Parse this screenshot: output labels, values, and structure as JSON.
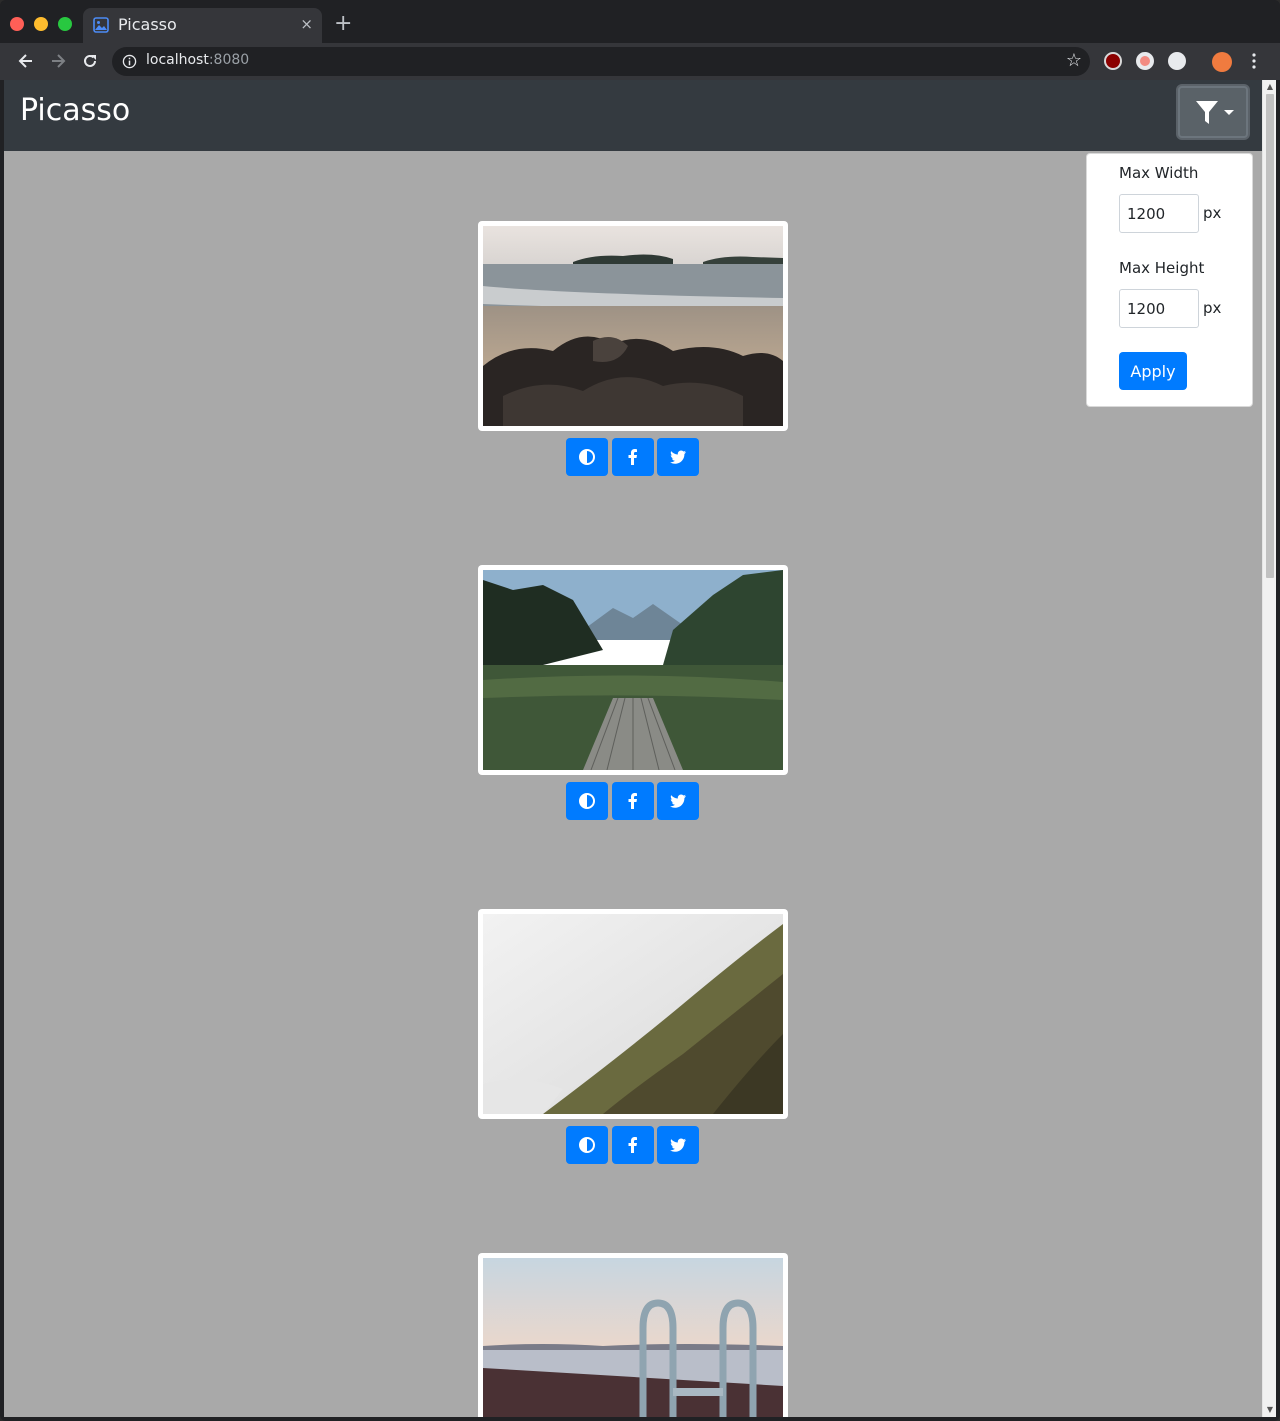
{
  "browser": {
    "tab_title": "Picasso",
    "tab_close": "×",
    "new_tab": "+",
    "url_host": "localhost",
    "url_port": ":8080"
  },
  "app": {
    "brand": "Picasso"
  },
  "filter": {
    "max_width_label": "Max Width",
    "max_width_value": "1200",
    "max_height_label": "Max Height",
    "max_height_value": "1200",
    "unit": "px",
    "apply_label": "Apply"
  },
  "gallery": {
    "images": [
      {
        "scene": "beach-rocks"
      },
      {
        "scene": "lake-pier"
      },
      {
        "scene": "foggy-forest"
      },
      {
        "scene": "pool-ladder"
      }
    ],
    "actions": [
      "contrast-icon",
      "facebook-icon",
      "twitter-icon"
    ]
  },
  "colors": {
    "navbar": "#343a40",
    "page_bg": "#a9a9a9",
    "primary": "#007bff"
  }
}
